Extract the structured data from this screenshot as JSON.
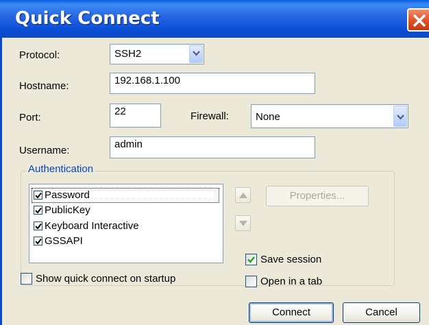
{
  "window": {
    "title": "Quick Connect"
  },
  "form": {
    "protocol": {
      "label": "Protocol:",
      "value": "SSH2"
    },
    "hostname": {
      "label": "Hostname:",
      "value": "192.168.1.100"
    },
    "port": {
      "label": "Port:",
      "value": "22"
    },
    "firewall": {
      "label": "Firewall:",
      "value": "None"
    },
    "username": {
      "label": "Username:",
      "value": "admin"
    }
  },
  "authentication": {
    "legend": "Authentication",
    "methods": [
      {
        "label": "Password",
        "checked": true
      },
      {
        "label": "PublicKey",
        "checked": true
      },
      {
        "label": "Keyboard Interactive",
        "checked": true
      },
      {
        "label": "GSSAPI",
        "checked": true
      }
    ],
    "properties_label": "Properties..."
  },
  "options": {
    "show_quick_connect": {
      "label": "Show quick connect on startup",
      "checked": false
    },
    "save_session": {
      "label": "Save session",
      "checked": true
    },
    "open_in_tab": {
      "label": "Open in a tab",
      "checked": false
    }
  },
  "buttons": {
    "connect": "Connect",
    "cancel": "Cancel"
  },
  "icons": {
    "close": "close-icon",
    "dropdown": "chevron-down-icon",
    "move_up": "arrow-up-icon",
    "move_down": "arrow-down-icon",
    "check": "checkmark-icon"
  },
  "colors": {
    "titlebar": "#0a4fd6",
    "close_button": "#e2542d",
    "dialog_background": "#ece9d8",
    "group_legend": "#0046d5",
    "checkmark": "#21a121"
  }
}
